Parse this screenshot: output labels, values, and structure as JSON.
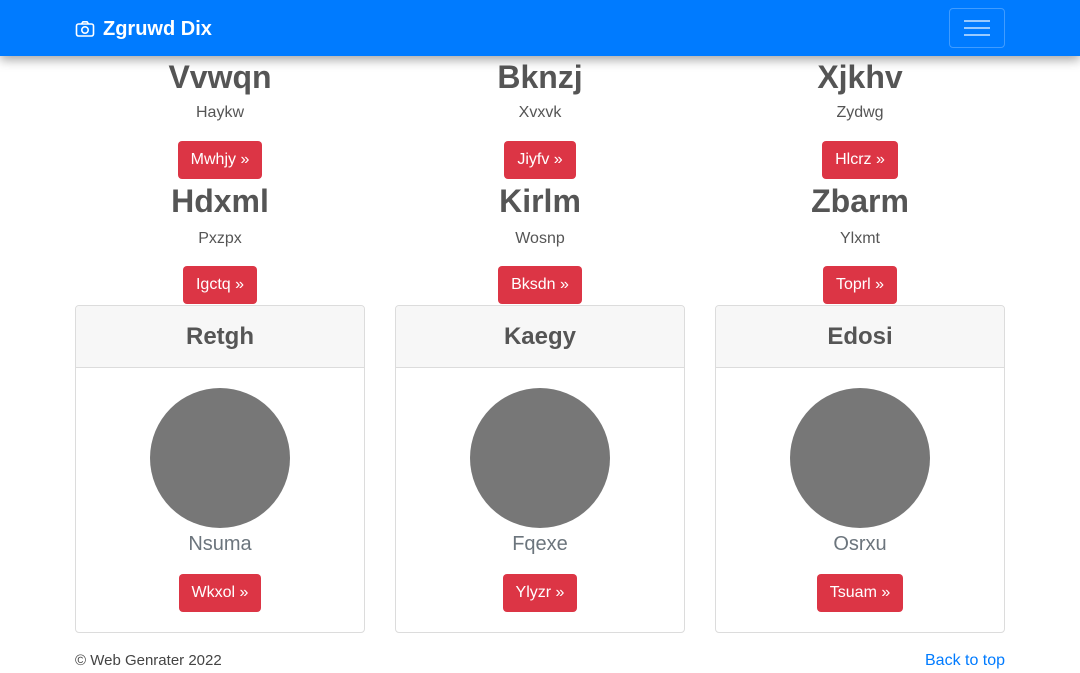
{
  "navbar": {
    "brand": "Zgruwd Dix",
    "brand_icon": "camera-icon",
    "toggler_icon": "hamburger-icon"
  },
  "features": [
    {
      "title": "Vvwqn",
      "subtitle": "Haykw",
      "button": "Mwhjy »"
    },
    {
      "title": "Bknzj",
      "subtitle": "Xvxvk",
      "button": "Jiyfv »"
    },
    {
      "title": "Xjkhv",
      "subtitle": "Zydwg",
      "button": "Hlcrz »"
    },
    {
      "title": "Hdxml",
      "subtitle": "Pxzpx",
      "button": "Igctq »"
    },
    {
      "title": "Kirlm",
      "subtitle": "Wosnp",
      "button": "Bksdn »"
    },
    {
      "title": "Zbarm",
      "subtitle": "Ylxmt",
      "button": "Toprl »"
    }
  ],
  "cards": [
    {
      "header": "Retgh",
      "name": "Nsuma",
      "button": "Wkxol »"
    },
    {
      "header": "Kaegy",
      "name": "Fqexe",
      "button": "Ylyzr »"
    },
    {
      "header": "Edosi",
      "name": "Osrxu",
      "button": "Tsuam »"
    }
  ],
  "footer": {
    "copyright": "© Web Genrater 2022",
    "back_to_top": "Back to top"
  },
  "colors": {
    "primary": "#007bff",
    "danger": "#dc3545",
    "avatar": "#777777"
  }
}
